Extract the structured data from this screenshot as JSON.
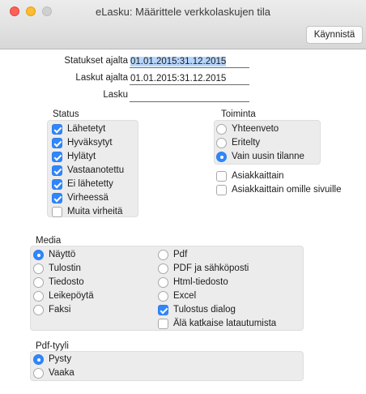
{
  "window": {
    "title": "eLasku: Määrittele verkkolaskujen tila",
    "start_button": "Käynnistä"
  },
  "fields": {
    "status_period_label": "Statukset ajalta",
    "status_period_prefix": "01.01.2015:31.12.2015",
    "status_period_selected": "01.01.2015:31.12.2015",
    "invoice_period_label": "Laskut ajalta",
    "invoice_period_value": "01.01.2015:31.12.2015",
    "invoice_label": "Lasku",
    "invoice_value": ""
  },
  "status": {
    "title": "Status",
    "items": [
      {
        "label": "Lähetetyt",
        "checked": true
      },
      {
        "label": "Hyväksytyt",
        "checked": true
      },
      {
        "label": "Hylätyt",
        "checked": true
      },
      {
        "label": "Vastaanotettu",
        "checked": true
      },
      {
        "label": "Ei lähetetty",
        "checked": true
      },
      {
        "label": "Virheessä",
        "checked": true
      },
      {
        "label": "Muita virheitä",
        "checked": false
      }
    ]
  },
  "toiminta": {
    "title": "Toiminta",
    "radios": [
      {
        "label": "Yhteenveto",
        "selected": false
      },
      {
        "label": "Eritelty",
        "selected": false
      },
      {
        "label": "Vain uusin tilanne",
        "selected": true
      }
    ],
    "checks": [
      {
        "label": "Asiakkaittain",
        "checked": false
      },
      {
        "label": "Asiakkaittain omille sivuille",
        "checked": false
      }
    ]
  },
  "media": {
    "title": "Media",
    "left": [
      {
        "label": "Näyttö",
        "selected": true
      },
      {
        "label": "Tulostin",
        "selected": false
      },
      {
        "label": "Tiedosto",
        "selected": false
      },
      {
        "label": "Leikepöytä",
        "selected": false
      },
      {
        "label": "Faksi",
        "selected": false
      }
    ],
    "right_radios": [
      {
        "label": "Pdf",
        "selected": false
      },
      {
        "label": "PDF ja sähköposti",
        "selected": false
      },
      {
        "label": "Html-tiedosto",
        "selected": false
      },
      {
        "label": "Excel",
        "selected": false
      }
    ],
    "right_checks": [
      {
        "label": "Tulostus dialog",
        "checked": true
      },
      {
        "label": "Älä katkaise latautumista",
        "checked": false
      }
    ]
  },
  "pdf_style": {
    "title": "Pdf-tyyli",
    "radios": [
      {
        "label": "Pysty",
        "selected": true
      },
      {
        "label": "Vaaka",
        "selected": false
      }
    ]
  },
  "colors": {
    "accent": "#2f86ff",
    "selection": "#b5d5ff",
    "group_bg": "#ececec"
  }
}
